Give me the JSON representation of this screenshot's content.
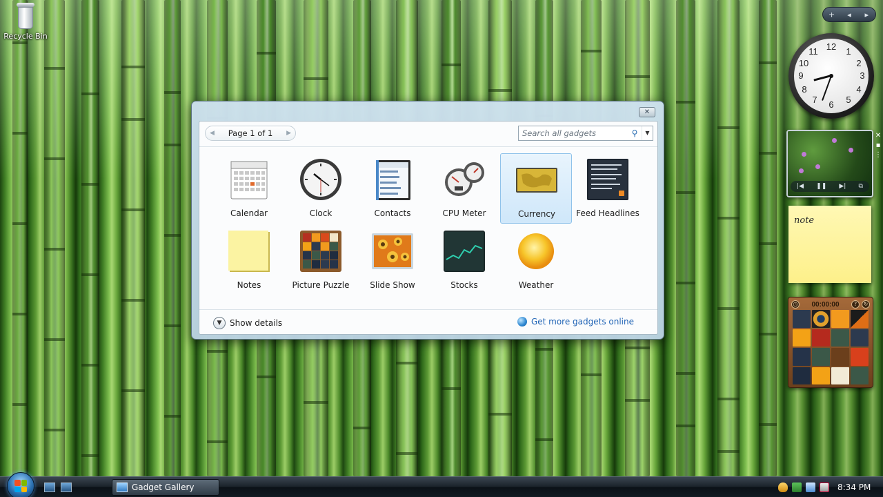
{
  "desktop": {
    "recycle_bin_label": "Recycle Bin"
  },
  "sidebar": {
    "controls": [
      "+",
      "◂",
      "▸"
    ],
    "notes_text": "note",
    "puzzle_timer": "00:00:00",
    "puzzle_buttons": [
      "?",
      "↻"
    ]
  },
  "gallery": {
    "title": "Gadget Gallery",
    "close_symbol": "✕",
    "pager_label": "Page 1 of 1",
    "pager_prev": "◀",
    "pager_next": "▶",
    "search_placeholder": "Search all gadgets",
    "search_icon": "⚲",
    "search_dropdown": "▼",
    "gadgets": [
      {
        "name": "Calendar"
      },
      {
        "name": "Clock"
      },
      {
        "name": "Contacts"
      },
      {
        "name": "CPU Meter"
      },
      {
        "name": "Currency",
        "selected": true
      },
      {
        "name": "Feed Headlines"
      },
      {
        "name": "Notes"
      },
      {
        "name": "Picture Puzzle"
      },
      {
        "name": "Slide Show"
      },
      {
        "name": "Stocks"
      },
      {
        "name": "Weather"
      }
    ],
    "show_details_label": "Show details",
    "get_more_label": "Get more gadgets online"
  },
  "taskbar": {
    "active_window_label": "Gadget Gallery",
    "time": "8:34 PM"
  },
  "colors": {
    "link": "#1f63b5",
    "selection": "#cfe7fa",
    "note_yellow": "#fdf08a"
  }
}
